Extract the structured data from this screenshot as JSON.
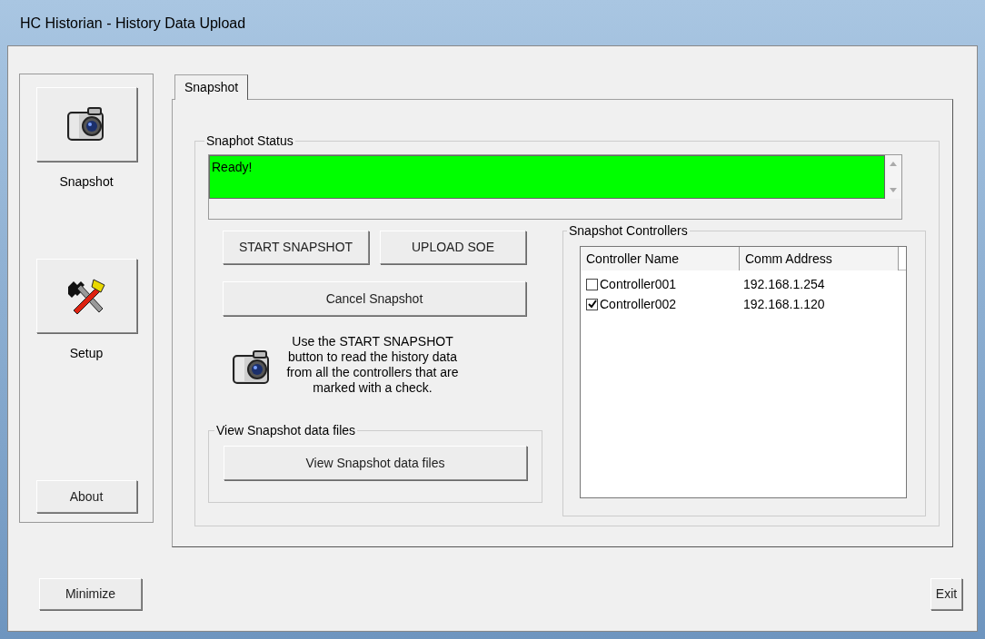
{
  "window": {
    "title": "HC Historian - History Data Upload"
  },
  "sidebar": {
    "items": [
      {
        "kind": "icon",
        "label": "Snapshot"
      },
      {
        "kind": "icon",
        "label": "Setup"
      },
      {
        "kind": "button",
        "label": "About"
      }
    ]
  },
  "tabs": [
    {
      "label": "Snapshot",
      "selected": true
    }
  ],
  "status_group": {
    "title": "Snaphot Status",
    "status": "Ready!"
  },
  "buttons": [
    "START SNAPSHOT",
    "UPLOAD SOE"
  ],
  "cancel_button": "Cancel Snapshot",
  "help_text": "Use the START SNAPSHOT button to read the history data from all the controllers that are marked with a check.",
  "files_group": {
    "title": "View Snapshot data files",
    "button": "View Snapshot data files"
  },
  "controllers": {
    "title": "Snapshot Controllers",
    "columns": [
      "Controller Name",
      "Comm Address"
    ],
    "rows": [
      {
        "name": "Controller001",
        "address": "192.168.1.254",
        "checked": false
      },
      {
        "name": "Controller002",
        "address": "192.168.1.120",
        "checked": true
      }
    ]
  },
  "footer": {
    "minimize": "Minimize",
    "exit": "Exit"
  }
}
